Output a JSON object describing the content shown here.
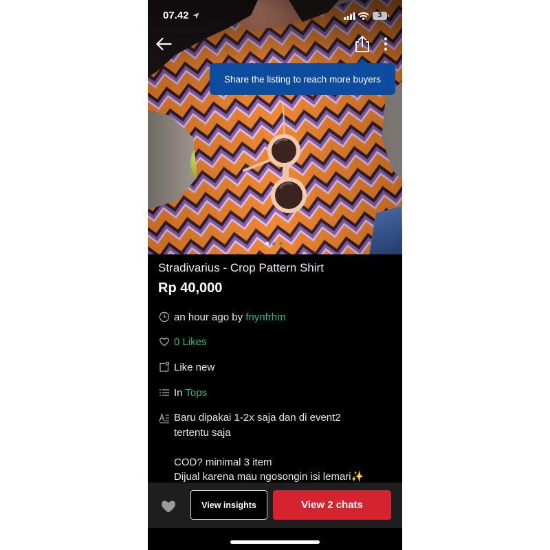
{
  "status_bar": {
    "time": "07.42",
    "battery_level": "3",
    "icons": [
      "location-arrow-icon",
      "cellular-signal-icon",
      "wifi-icon",
      "battery-icon"
    ]
  },
  "top_nav": {
    "icons": [
      "back-arrow-icon",
      "share-icon",
      "more-vertical-icon"
    ]
  },
  "share_tooltip": {
    "text": "Share the listing to reach more buyers"
  },
  "gallery": {
    "image_count": 3,
    "active_index": 0
  },
  "listing": {
    "title": "Stradivarius - Crop Pattern Shirt",
    "price": "Rp 40,000",
    "posted_text": "an hour ago by",
    "seller": "fnynfrhm",
    "likes": "0 Likes",
    "condition": "Like new",
    "category_prefix": "In",
    "category": "Tops",
    "description": {
      "paragraphs": [
        [
          "Baru dipakai 1-2x saja dan di event2",
          "tertentu saja"
        ],
        [
          "COD? minimal 3 item",
          "Dijual karena mau ngosongin isi lemari"
        ]
      ],
      "emoji": "✨"
    },
    "row_icons": [
      "clock-icon",
      "heart-outline-icon",
      "condition-tag-icon",
      "category-list-icon",
      "description-text-icon"
    ]
  },
  "bottom_bar": {
    "favorite_icon": "heart-filled-icon",
    "insights_label": "View insights",
    "chats_label": "View 2 chats"
  },
  "colors": {
    "screen_background": "#000000",
    "accent_green": "#38b48e",
    "tooltip_blue": "#0d4b9f",
    "primary_red": "#d5232f",
    "bottom_bar": "#1e1e1e"
  }
}
